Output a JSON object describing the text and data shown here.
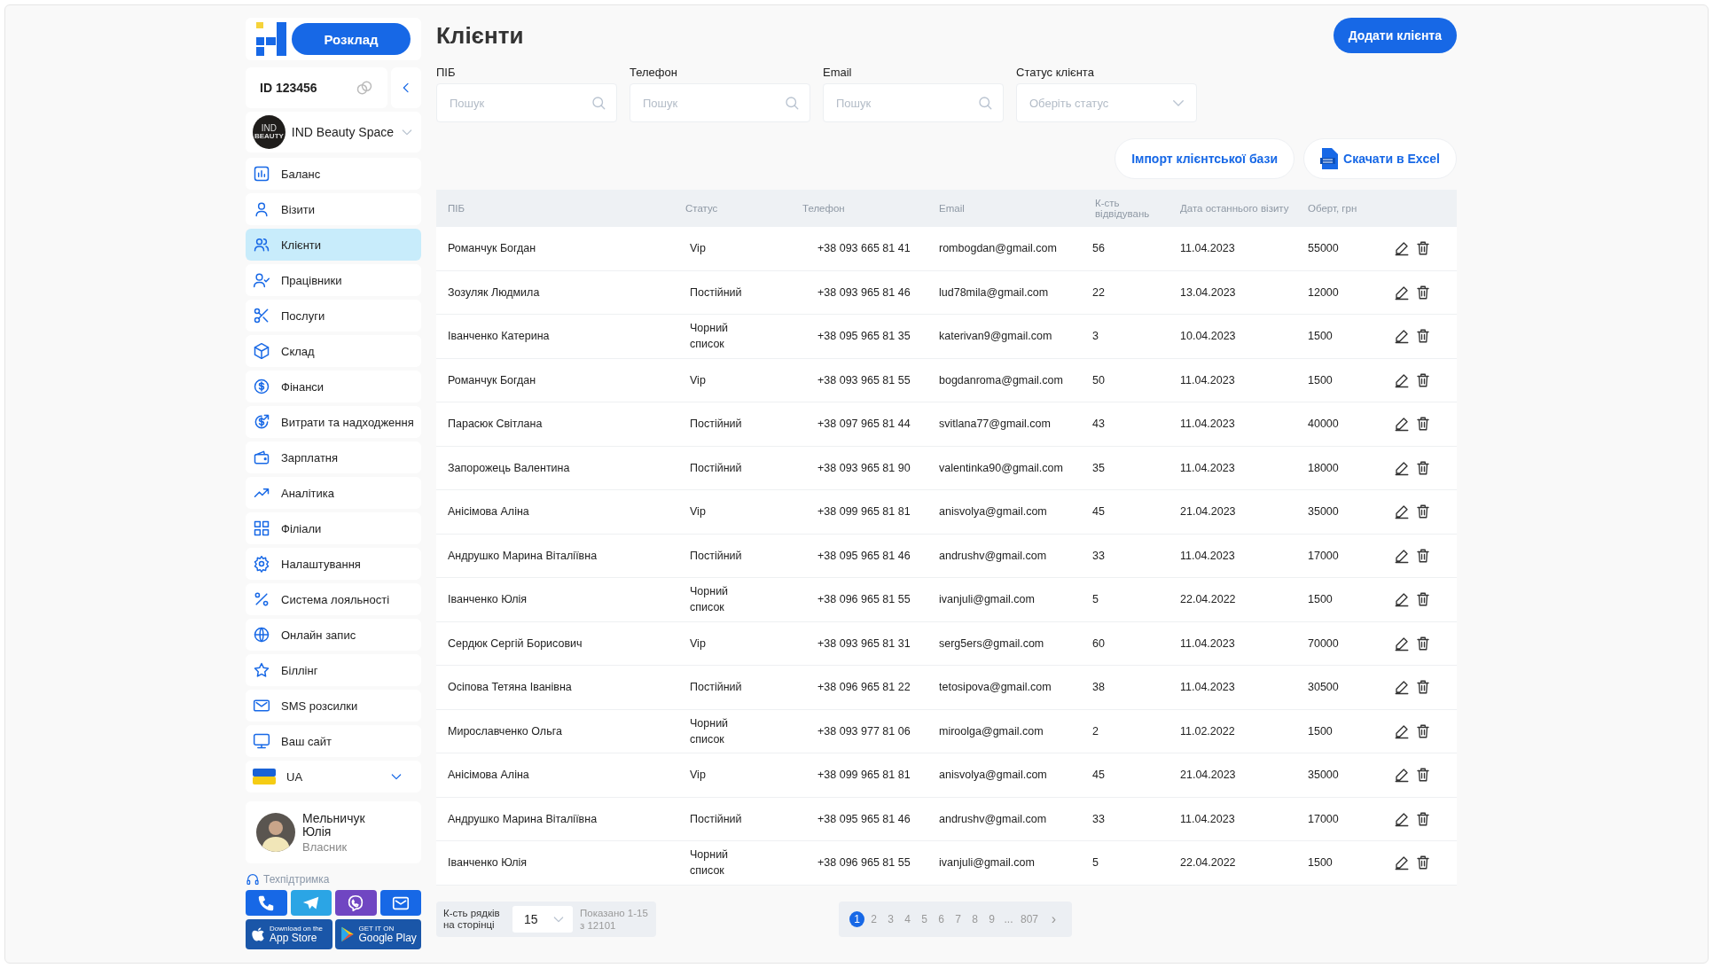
{
  "sidebar": {
    "schedule_button": "Розклад",
    "account_id": "ID 123456",
    "salon": {
      "name": "IND Beauty Space",
      "logo_text": "IND",
      "logo_subtext": "BEAUTY"
    },
    "items": [
      {
        "label": "Баланс",
        "selected": false
      },
      {
        "label": "Візити",
        "selected": false
      },
      {
        "label": "Клієнти",
        "selected": true
      },
      {
        "label": "Працівники",
        "selected": false
      },
      {
        "label": "Послуги",
        "selected": false
      },
      {
        "label": "Склад",
        "selected": false
      },
      {
        "label": "Фінанси",
        "selected": false
      },
      {
        "label": "Витрати та надходження",
        "selected": false
      },
      {
        "label": "Зарплатня",
        "selected": false
      },
      {
        "label": "Аналітика",
        "selected": false
      },
      {
        "label": "Філіали",
        "selected": false
      },
      {
        "label": "Налаштування",
        "selected": false
      },
      {
        "label": "Система лояльності",
        "selected": false
      },
      {
        "label": "Онлайн запис",
        "selected": false
      },
      {
        "label": "Біллінг",
        "selected": false
      },
      {
        "label": "SMS розсилки",
        "selected": false
      },
      {
        "label": "Ваш сайт",
        "selected": false
      }
    ],
    "language": "UA",
    "user": {
      "name": "Мельничук Юлія",
      "role": "Власник"
    },
    "support_label": "Техпідтримка",
    "stores": [
      {
        "small": "Download on the",
        "big": "App Store"
      },
      {
        "small": "GET IT ON",
        "big": "Google Play"
      }
    ]
  },
  "page": {
    "title": "Клієнти",
    "add_button": "Додати клієнта"
  },
  "filters": [
    {
      "label": "ПІБ",
      "placeholder": "Пошук",
      "kind": "search"
    },
    {
      "label": "Телефон",
      "placeholder": "Пошук",
      "kind": "search"
    },
    {
      "label": "Email",
      "placeholder": "Пошук",
      "kind": "search"
    },
    {
      "label": "Статус клієнта",
      "placeholder": "Оберіть статус",
      "kind": "select"
    }
  ],
  "actions": [
    {
      "label": "Імпорт клієнтської бази",
      "kind": "plain"
    },
    {
      "label": "Скачати в Excel",
      "kind": "excel"
    }
  ],
  "table": {
    "columns": [
      "ПІБ",
      "Статус",
      "Телефон",
      "Email",
      "К-сть відвідувань",
      "Дата останнього візиту",
      "Оберт, грн"
    ],
    "rows": [
      [
        "Романчук Богдан",
        "Vip",
        "+38 093 665 81 41",
        "rombogdan@gmail.com",
        "56",
        "11.04.2023",
        "55000"
      ],
      [
        "Зозуляк Людмила",
        "Постійний",
        "+38 093 965 81 46",
        "lud78mila@gmail.com",
        "22",
        "13.04.2023",
        "12000"
      ],
      [
        "Іванченко Катерина",
        "Чорний список",
        "+38 095 965 81 35",
        "katerivan9@gmail.com",
        "3",
        "10.04.2023",
        "1500"
      ],
      [
        "Романчук Богдан",
        "Vip",
        "+38 093 965 81 55",
        "bogdanroma@gmail.com",
        "50",
        "11.04.2023",
        "1500"
      ],
      [
        "Парасюк Світлана",
        "Постійний",
        "+38 097 965 81 44",
        "svitlana77@gmail.com",
        "43",
        "11.04.2023",
        "40000"
      ],
      [
        "Запорожець Валентина",
        "Постійний",
        "+38 093 965 81 90",
        "valentinka90@gmail.com",
        "35",
        "11.04.2023",
        "18000"
      ],
      [
        "Анісімова Аліна",
        "Vip",
        "+38 099 965 81 81",
        "anisvolya@gmail.com",
        "45",
        "21.04.2023",
        "35000"
      ],
      [
        "Андрушко Марина Віталіївна",
        "Постійний",
        "+38 095 965 81 46",
        "andrushv@gmail.com",
        "33",
        "11.04.2023",
        "17000"
      ],
      [
        "Іванченко Юлія",
        "Чорний список",
        "+38 096 965 81 55",
        "ivanjuli@gmail.com",
        "5",
        "22.04.2022",
        "1500"
      ],
      [
        "Сердюк Сергій Борисович",
        "Vip",
        "+38 093 965 81 31",
        "serg5ers@gmail.com",
        "60",
        "11.04.2023",
        "70000"
      ],
      [
        "Осіпова Тетяна Іванівна",
        "Постійний",
        "+38 096 965 81 22",
        "tetosipova@gmail.com",
        "38",
        "11.04.2023",
        "30500"
      ],
      [
        "Мирославченко Ольга",
        "Чорний список",
        "+38 093 977 81 06",
        "miroolga@gmail.com",
        "2",
        "11.02.2022",
        "1500"
      ],
      [
        "Анісімова Аліна",
        "Vip",
        "+38 099 965 81 81",
        "anisvolya@gmail.com",
        "45",
        "21.04.2023",
        "35000"
      ],
      [
        "Андрушко Марина Віталіївна",
        "Постійний",
        "+38 095 965 81 46",
        "andrushv@gmail.com",
        "33",
        "11.04.2023",
        "17000"
      ],
      [
        "Іванченко Юлія",
        "Чорний список",
        "+38 096 965 81 55",
        "ivanjuli@gmail.com",
        "5",
        "22.04.2022",
        "1500"
      ]
    ]
  },
  "footer": {
    "rows_label": "К-сть рядків на сторінці",
    "rows_value": "15",
    "shown": "Показано 1-15 з 12101",
    "pages": [
      {
        "label": "1",
        "selected": true
      },
      {
        "label": "2",
        "selected": false
      },
      {
        "label": "3",
        "selected": false
      },
      {
        "label": "4",
        "selected": false
      },
      {
        "label": "5",
        "selected": false
      },
      {
        "label": "6",
        "selected": false
      },
      {
        "label": "7",
        "selected": false
      },
      {
        "label": "8",
        "selected": false
      },
      {
        "label": "9",
        "selected": false
      },
      {
        "label": "...",
        "selected": false
      },
      {
        "label": "807",
        "selected": false
      }
    ],
    "next": "›"
  }
}
